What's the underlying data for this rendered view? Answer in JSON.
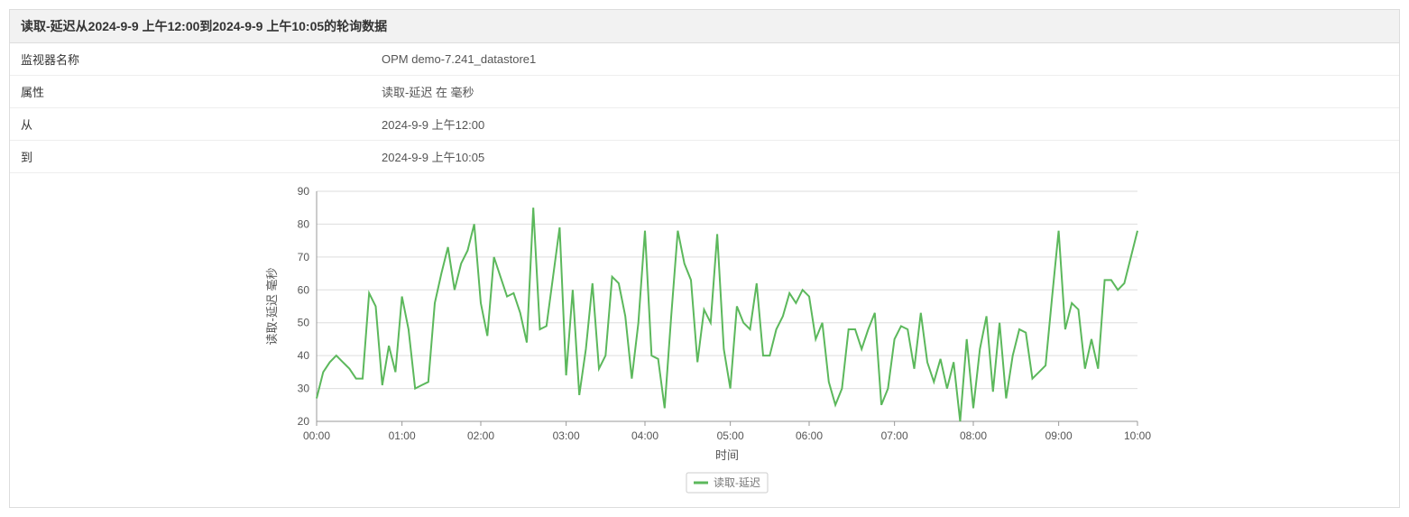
{
  "header": {
    "title": "读取-延迟从2024-9-9 上午12:00到2024-9-9 上午10:05的轮询数据"
  },
  "info": {
    "monitor_name_label": "监视器名称",
    "monitor_name_value": "OPM demo-7.241_datastore1",
    "attribute_label": "属性",
    "attribute_value": "读取-延迟 在 毫秒",
    "from_label": "从",
    "from_value": "2024-9-9 上午12:00",
    "to_label": "到",
    "to_value": "2024-9-9 上午10:05"
  },
  "chart_data": {
    "type": "line",
    "title": "",
    "xlabel": "时间",
    "ylabel": "读取-延迟 毫秒",
    "ylim": [
      20,
      90
    ],
    "y_ticks": [
      20,
      30,
      40,
      50,
      60,
      70,
      80,
      90
    ],
    "x_ticks": [
      "00:00",
      "01:00",
      "02:00",
      "03:00",
      "04:00",
      "05:00",
      "06:00",
      "07:00",
      "08:00",
      "09:00",
      "10:00"
    ],
    "series": [
      {
        "name": "读取-延迟",
        "color": "#5cb85c",
        "x_step_minutes": 5,
        "values": [
          27,
          35,
          38,
          40,
          38,
          36,
          33,
          33,
          59,
          55,
          31,
          43,
          35,
          58,
          48,
          30,
          31,
          32,
          56,
          65,
          73,
          60,
          68,
          72,
          80,
          56,
          46,
          70,
          64,
          58,
          59,
          53,
          44,
          85,
          48,
          49,
          64,
          79,
          34,
          60,
          28,
          42,
          62,
          36,
          40,
          64,
          62,
          52,
          33,
          50,
          78,
          40,
          39,
          24,
          52,
          78,
          68,
          63,
          38,
          54,
          50,
          77,
          42,
          30,
          55,
          50,
          48,
          62,
          40,
          40,
          48,
          52,
          59,
          56,
          60,
          58,
          45,
          50,
          32,
          25,
          30,
          48,
          48,
          42,
          48,
          53,
          25,
          30,
          45,
          49,
          48,
          36,
          53,
          38,
          32,
          39,
          30,
          38,
          20,
          45,
          24,
          42,
          52,
          29,
          50,
          27,
          40,
          48,
          47,
          33,
          35,
          37,
          58,
          78,
          48,
          56,
          54,
          36,
          45,
          36,
          63,
          63,
          60,
          62,
          70,
          78
        ]
      }
    ],
    "legend": [
      "读取-延迟"
    ]
  }
}
